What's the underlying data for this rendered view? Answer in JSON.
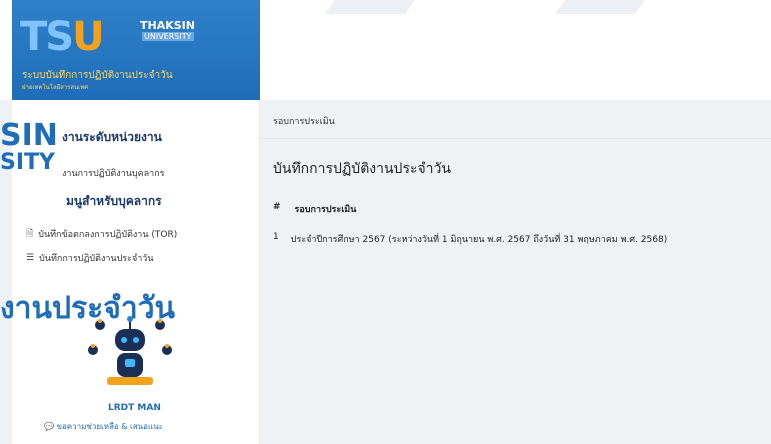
{
  "brand": {
    "logo_text": "TSU",
    "university_name": "THAKSIN",
    "university_sub": "UNIVERSITY",
    "system_title": "ระบบบันทึกการปฏิบัติงานประจำวัน",
    "system_subtitle": "ฝ่ายเทคโนโลยีสารสนเทศ"
  },
  "sidebar": {
    "section1_title": "งานระดับหน่วยงาน",
    "section1_items": [
      {
        "label": "งานการปฏิบัติงานบุคลากร"
      }
    ],
    "section2_title": "มนูสำหรับบุคลากร",
    "section2_items": [
      {
        "icon": "document-icon",
        "label": "บันทึกข้อตกลงการปฏิบัติงาน (TOR)"
      },
      {
        "icon": "list-icon",
        "label": "บันทึกการปฏิบัติงานประจำวัน"
      }
    ],
    "mascot_label": "LRDT MAN",
    "help_link": "ขอความช่วยเหลือ & เสนอแนะ"
  },
  "overlay": {
    "line1": "SIN",
    "line2": "SITY",
    "line3": "งานประจำวัน"
  },
  "main": {
    "breadcrumb": "รอบการประเมิน",
    "page_title": "บันทึกการปฏิบัติงานประจำวัน",
    "table": {
      "headers": [
        "#",
        "รอบการประเมิน"
      ],
      "rows": [
        [
          "1",
          "ประจำปีการศึกษา 2567 (ระหว่างวันที่ 1 มิถุนายน พ.ศ. 2567 ถึงวันที่ 31 พฤษภาคม พ.ศ. 2568)"
        ]
      ]
    }
  },
  "colors": {
    "brand_blue": "#1f6db8",
    "accent_yellow": "#ffd65c",
    "logo_orange": "#f2a21c"
  }
}
